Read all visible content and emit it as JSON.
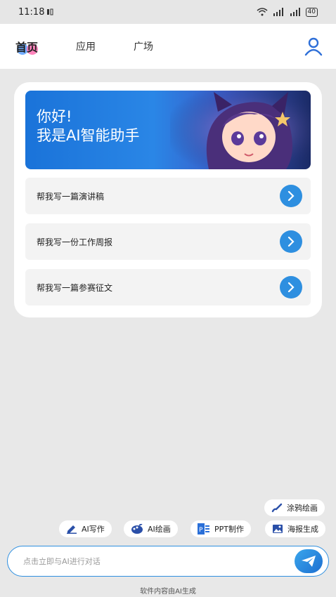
{
  "status_bar": {
    "time": "11:18",
    "signal": "≡ ╴░▏ ╴░▏",
    "battery": "40"
  },
  "header": {
    "tabs": [
      {
        "label": "首页",
        "active": true
      },
      {
        "label": "应用",
        "active": false
      },
      {
        "label": "广场",
        "active": false
      }
    ]
  },
  "banner": {
    "line1": "你好!",
    "line2": "我是AI智能助手"
  },
  "prompts": [
    {
      "label": "帮我写一篇演讲稿"
    },
    {
      "label": "帮我写一份工作周报"
    },
    {
      "label": "帮我写一篇参赛征文"
    }
  ],
  "chips": {
    "doodle": "涂鸦绘画",
    "ai_write": "AI写作",
    "ai_draw": "AI绘画",
    "ppt": "PPT制作",
    "poster": "海报生成"
  },
  "input": {
    "placeholder": "点击立即与AI进行对话"
  },
  "footer": "软件内容由AI生成",
  "colors": {
    "accent": "#2e8fe0",
    "background": "#e8e8e8",
    "card": "#ffffff"
  }
}
